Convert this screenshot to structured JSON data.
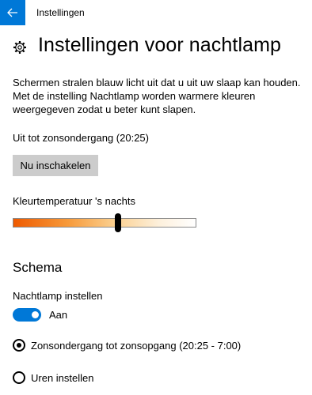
{
  "window": {
    "title": "Instellingen",
    "back_icon": "arrow-left-icon",
    "accent_color": "#0078d7"
  },
  "page": {
    "title": "Instellingen voor nachtlamp",
    "title_icon": "gear-icon",
    "description": "Schermen stralen blauw licht uit dat u uit uw slaap kan houden. Met de instelling Nachtlamp worden warmere kleuren weergegeven zodat u beter kunt slapen.",
    "status": "Uit tot zonsondergang (20:25)",
    "enable_button": "Nu inschakelen"
  },
  "slider": {
    "label": "Kleurtemperatuur 's nachts",
    "value_fraction": 0.58,
    "gradient_colors": [
      "#ee5a00",
      "#f79a3a",
      "#fbcf8e",
      "#fdf0dc",
      "#ffffff"
    ]
  },
  "schedule": {
    "heading": "Schema",
    "toggle_label": "Nachtlamp instellen",
    "toggle_state": "Aan",
    "toggle_on": true,
    "options": [
      {
        "label": "Zonsondergang tot zonsopgang (20:25 - 7:00)",
        "selected": true
      },
      {
        "label": "Uren instellen",
        "selected": false
      }
    ]
  }
}
